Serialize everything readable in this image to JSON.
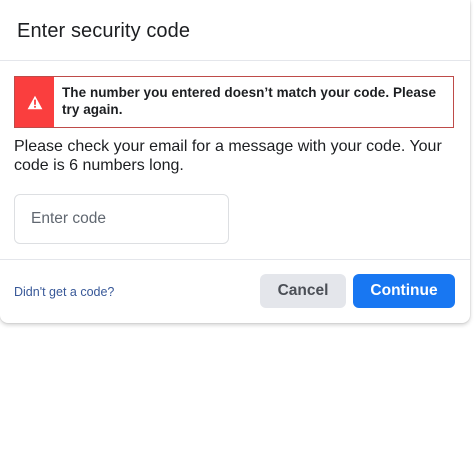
{
  "dialog": {
    "title": "Enter security code"
  },
  "error": {
    "icon": "warning-icon",
    "icon_bg_color": "#fa3e3e",
    "message": "The number you entered doesn’t match your code. Please try again."
  },
  "instructions": "Please check your email for a message with your code. Your code is 6 numbers long.",
  "code_input": {
    "placeholder": "Enter code",
    "value": ""
  },
  "footer": {
    "resend_link": "Didn't get a code?",
    "cancel_label": "Cancel",
    "continue_label": "Continue",
    "continue_color": "#1877f2"
  }
}
